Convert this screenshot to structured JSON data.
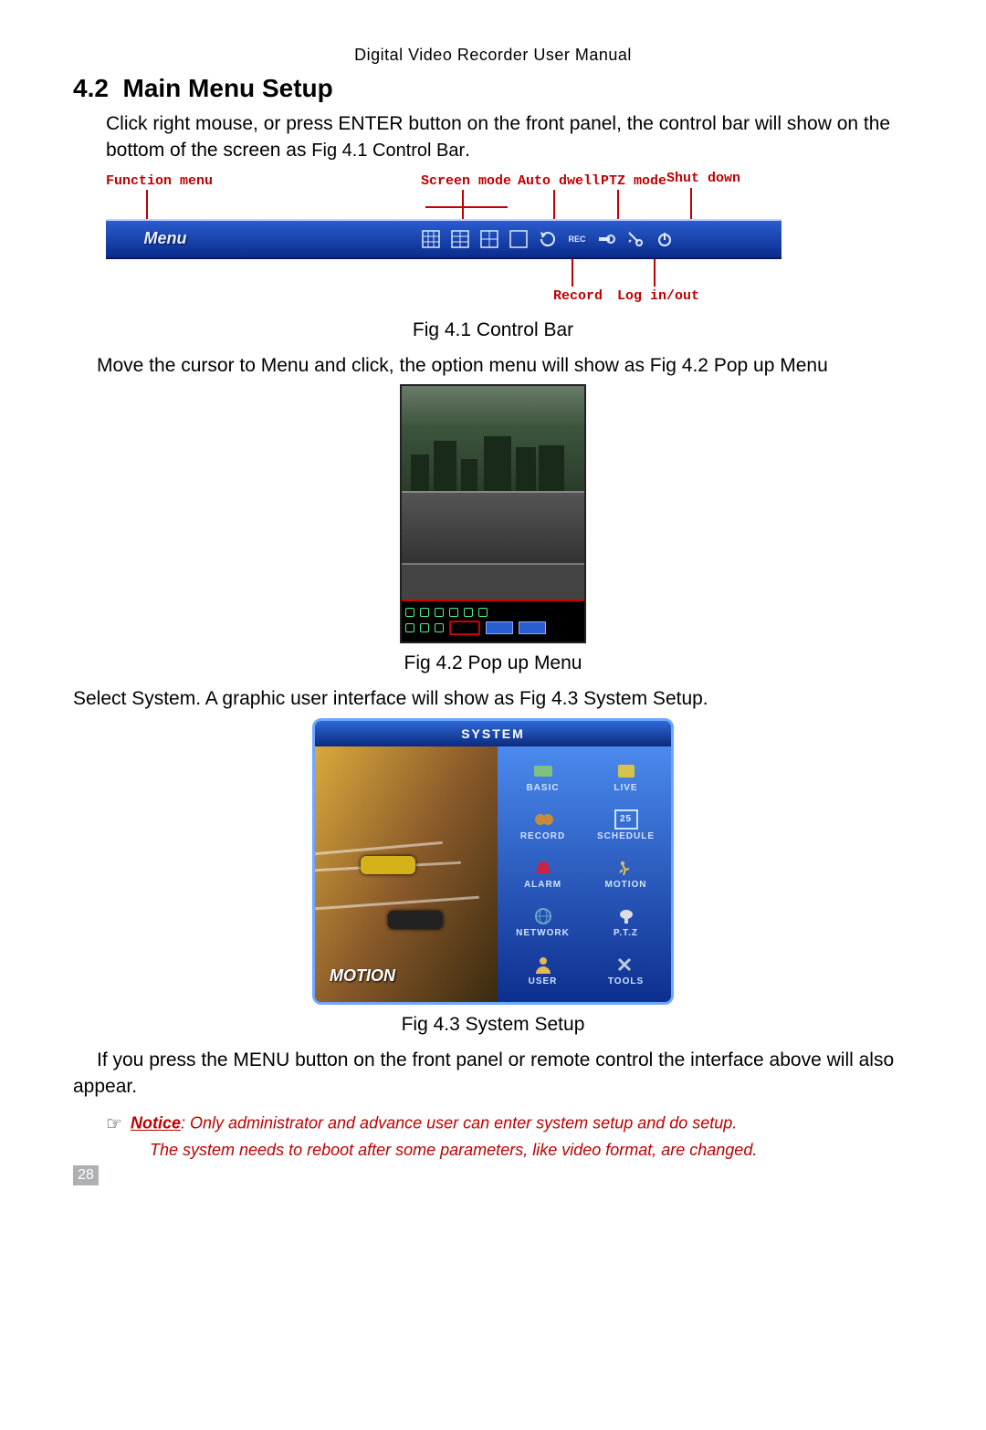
{
  "header": "Digital Video Recorder User Manual",
  "section_number": "4.2",
  "section_title": "Main Menu Setup",
  "intro": "Click right mouse, or press ENTER button on the front panel, the control bar will show on the bottom of the screen as ",
  "intro_ref": "Fig 4.1 Control Bar",
  "intro_period": ".",
  "controlbar": {
    "labels": {
      "function_menu": "Function menu",
      "screen_mode": "Screen mode",
      "auto_dwell": "Auto dwell",
      "ptz_mode": "PTZ mode",
      "shut_down": "Shut down",
      "record": "Record",
      "log_in_out": "Log in/out"
    },
    "menu_label": "Menu",
    "icon_rec": "REC"
  },
  "fig41_caption": "Fig 4.1 Control Bar",
  "para2": "Move the cursor to Menu and click, the option menu will show as Fig 4.2 Pop up Menu",
  "fig42_caption": "Fig 4.2 Pop up Menu",
  "para3": "Select System. A graphic user interface will show as Fig 4.3 System Setup.",
  "system": {
    "title": "SYSTEM",
    "motion_label": "MOTION",
    "schedule_num": "25",
    "items": [
      "BASIC",
      "LIVE",
      "RECORD",
      "SCHEDULE",
      "ALARM",
      "MOTION",
      "NETWORK",
      "P.T.Z",
      "USER",
      "TOOLS"
    ]
  },
  "fig43_caption": "Fig 4.3 System Setup",
  "para4": "If you press the MENU button on the front panel or remote control the interface above will also appear.",
  "notice": {
    "label": "Notice",
    "line1": ": Only administrator and advance user can enter system setup and do setup.",
    "line2": "The system needs to reboot after some parameters, like video format, are changed."
  },
  "page_number": "28"
}
